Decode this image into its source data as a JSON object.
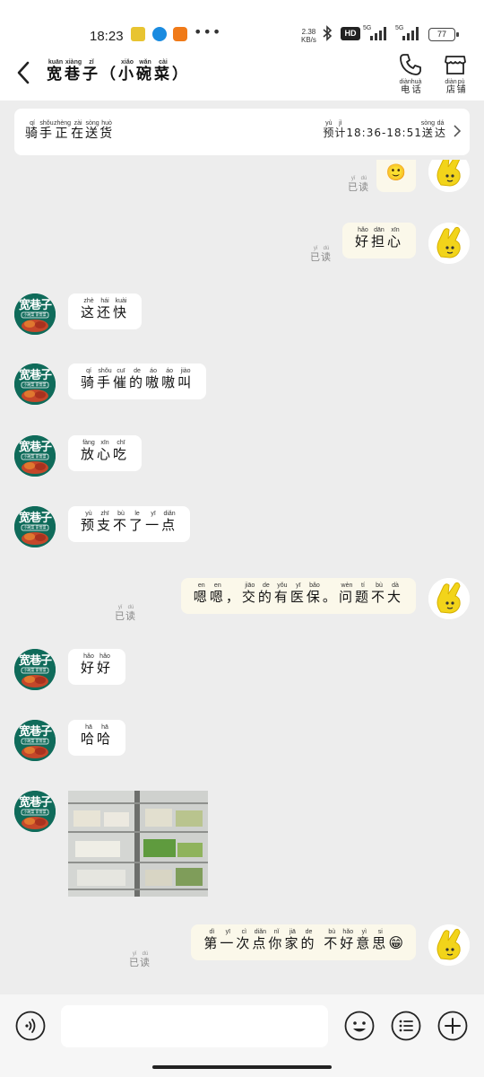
{
  "status_bar": {
    "time": "18:23",
    "net_speed_value": "2.38",
    "net_speed_unit": "KB/s",
    "hd_label": "HD",
    "sig1_label": "5G",
    "sig2_label": "5G",
    "battery": "77"
  },
  "header": {
    "title_chars": [
      {
        "char": "宽",
        "pinyin": "kuān"
      },
      {
        "char": "巷",
        "pinyin": "xiàng"
      },
      {
        "char": "子",
        "pinyin": "zǐ"
      },
      {
        "char": "（",
        "pinyin": ""
      },
      {
        "char": "小",
        "pinyin": "xiǎo"
      },
      {
        "char": "碗",
        "pinyin": "wǎn"
      },
      {
        "char": "菜",
        "pinyin": "cài"
      },
      {
        "char": "）",
        "pinyin": ""
      }
    ],
    "phone_label_chars": [
      {
        "char": "电",
        "pinyin": "diàn"
      },
      {
        "char": "话",
        "pinyin": "huà"
      }
    ],
    "shop_label_chars": [
      {
        "char": "店",
        "pinyin": "diàn"
      },
      {
        "char": "铺",
        "pinyin": "pù"
      }
    ]
  },
  "delivery": {
    "status_chars": [
      {
        "char": "骑",
        "pinyin": "qí"
      },
      {
        "char": "手",
        "pinyin": "shǒu"
      },
      {
        "char": "正",
        "pinyin": "zhèng"
      },
      {
        "char": "在",
        "pinyin": "zài"
      },
      {
        "char": "送",
        "pinyin": "sòng"
      },
      {
        "char": "货",
        "pinyin": "huò"
      }
    ],
    "eta_pre_chars": [
      {
        "char": "预",
        "pinyin": "yù"
      },
      {
        "char": "计",
        "pinyin": "jì"
      }
    ],
    "eta_time": "18:36-18:51",
    "eta_post_chars": [
      {
        "char": "送",
        "pinyin": "sòng"
      },
      {
        "char": "达",
        "pinyin": "dá"
      }
    ]
  },
  "read_label_chars": [
    {
      "char": "已",
      "pinyin": "yǐ"
    },
    {
      "char": "读",
      "pinyin": "dú"
    }
  ],
  "messages": [
    {
      "id": "m0",
      "side": "out",
      "emoji": "🙂"
    },
    {
      "id": "m1",
      "side": "out",
      "chars": [
        {
          "char": "好",
          "pinyin": "hǎo"
        },
        {
          "char": "担",
          "pinyin": "dān"
        },
        {
          "char": "心",
          "pinyin": "xīn"
        }
      ]
    },
    {
      "id": "m2",
      "side": "in",
      "chars": [
        {
          "char": "这",
          "pinyin": "zhè"
        },
        {
          "char": "还",
          "pinyin": "hái"
        },
        {
          "char": "快",
          "pinyin": "kuài"
        }
      ]
    },
    {
      "id": "m3",
      "side": "in",
      "chars": [
        {
          "char": "骑",
          "pinyin": "qí"
        },
        {
          "char": "手",
          "pinyin": "shǒu"
        },
        {
          "char": "催",
          "pinyin": "cuī"
        },
        {
          "char": "的",
          "pinyin": "de"
        },
        {
          "char": "嗷",
          "pinyin": "áo"
        },
        {
          "char": "嗷",
          "pinyin": "áo"
        },
        {
          "char": "叫",
          "pinyin": "jiào"
        }
      ]
    },
    {
      "id": "m4",
      "side": "in",
      "chars": [
        {
          "char": "放",
          "pinyin": "fàng"
        },
        {
          "char": "心",
          "pinyin": "xīn"
        },
        {
          "char": "吃",
          "pinyin": "chī"
        }
      ]
    },
    {
      "id": "m5",
      "side": "in",
      "chars": [
        {
          "char": "预",
          "pinyin": "yù"
        },
        {
          "char": "支",
          "pinyin": "zhī"
        },
        {
          "char": "不",
          "pinyin": "bù"
        },
        {
          "char": "了",
          "pinyin": "le"
        },
        {
          "char": "一",
          "pinyin": "yī"
        },
        {
          "char": "点",
          "pinyin": "diǎn"
        }
      ]
    },
    {
      "id": "m6",
      "side": "out",
      "chars": [
        {
          "char": "嗯",
          "pinyin": "en"
        },
        {
          "char": "嗯",
          "pinyin": "en"
        },
        {
          "char": "，",
          "pinyin": ""
        },
        {
          "char": "交",
          "pinyin": "jiāo"
        },
        {
          "char": "的",
          "pinyin": "de"
        },
        {
          "char": "有",
          "pinyin": "yǒu"
        },
        {
          "char": "医",
          "pinyin": "yī"
        },
        {
          "char": "保",
          "pinyin": "bǎo"
        },
        {
          "char": "。",
          "pinyin": ""
        },
        {
          "char": "问",
          "pinyin": "wèn"
        },
        {
          "char": "题",
          "pinyin": "tí"
        },
        {
          "char": "不",
          "pinyin": "bù"
        },
        {
          "char": "大",
          "pinyin": "dà"
        }
      ]
    },
    {
      "id": "m7",
      "side": "in",
      "chars": [
        {
          "char": "好",
          "pinyin": "hǎo"
        },
        {
          "char": "好",
          "pinyin": "hǎo"
        }
      ]
    },
    {
      "id": "m8",
      "side": "in",
      "chars": [
        {
          "char": "哈",
          "pinyin": "hā"
        },
        {
          "char": "哈",
          "pinyin": "hā"
        }
      ]
    },
    {
      "id": "m9",
      "side": "in",
      "type": "image"
    },
    {
      "id": "m10",
      "side": "out",
      "chars": [
        {
          "char": "第",
          "pinyin": "dì"
        },
        {
          "char": "一",
          "pinyin": "yī"
        },
        {
          "char": "次",
          "pinyin": "cì"
        },
        {
          "char": "点",
          "pinyin": "diǎn"
        },
        {
          "char": "你",
          "pinyin": "nǐ"
        },
        {
          "char": "家",
          "pinyin": "jiā"
        },
        {
          "char": "的",
          "pinyin": "de"
        },
        {
          "char": " ",
          "pinyin": ""
        },
        {
          "char": "不",
          "pinyin": "bù"
        },
        {
          "char": "好",
          "pinyin": "hǎo"
        },
        {
          "char": "意",
          "pinyin": "yì"
        },
        {
          "char": "思",
          "pinyin": "si"
        }
      ],
      "emoji": "😁"
    }
  ],
  "shop_avatar": {
    "line1": "宽巷子",
    "line2": "小碗菜 家常菜"
  },
  "colors": {
    "bubble_out": "#fbf8ea",
    "bubble_in": "#ffffff",
    "shop_green": "#0f6b5a",
    "self_yellow": "#f2d41a"
  }
}
